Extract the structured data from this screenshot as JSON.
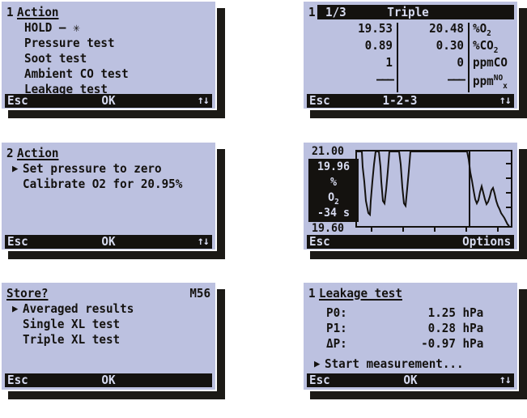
{
  "display": {
    "bg_color": "#bcc1e0",
    "fg_color": "#14120f",
    "border_color": "#ffffff",
    "shadow_color": "#1c1a16"
  },
  "panels": {
    "action_menu": {
      "index": "1",
      "title": "Action",
      "items": [
        {
          "label": "HOLD – ✳",
          "selected": false
        },
        {
          "label": "Pressure test",
          "selected": false
        },
        {
          "label": "Soot test",
          "selected": false
        },
        {
          "label": "Ambient CO test",
          "selected": false
        },
        {
          "label": "Leakage test",
          "selected": false
        }
      ],
      "statusbar": {
        "left": "Esc",
        "center": "OK",
        "right": "↑↓"
      }
    },
    "triple_measurement": {
      "index": "1",
      "header_left": "1/3",
      "header_center": "Triple",
      "rows": [
        {
          "col1": "19.53",
          "col2": "20.48",
          "unit": "%O",
          "unit_sub": "2",
          "unit_sup": ""
        },
        {
          "col1": "0.89",
          "col2": "0.30",
          "unit": "%CO",
          "unit_sub": "2",
          "unit_sup": ""
        },
        {
          "col1": "1",
          "col2": "0",
          "unit": "ppmCO",
          "unit_sub": "",
          "unit_sup": ""
        },
        {
          "col1": "———",
          "col2": "———",
          "unit": "ppm",
          "unit_sub": "x",
          "unit_sup": "NO"
        }
      ],
      "statusbar": {
        "left": "Esc",
        "center": "1-2-3",
        "right": "↑↓"
      }
    },
    "action_calibration": {
      "index": "2",
      "title": "Action",
      "items": [
        {
          "label": "Set pressure to zero",
          "selected": true
        },
        {
          "label": "Calibrate O2 for 20.95%",
          "selected": false
        }
      ],
      "statusbar": {
        "left": "Esc",
        "center": "OK",
        "right": "↑↓"
      }
    },
    "trend_graph": {
      "axis_top_label": "21.00",
      "axis_bottom_label": "19.60",
      "readout": {
        "value": "19.96",
        "unit": "%",
        "gas": "O",
        "gas_sub": "2",
        "time": "-34 s"
      },
      "statusbar": {
        "left": "Esc",
        "right": "Options"
      }
    },
    "store_dialog": {
      "title": "Store?",
      "memory": "M56",
      "items": [
        {
          "label": "Averaged results",
          "selected": true
        },
        {
          "label": "Single XL test",
          "selected": false
        },
        {
          "label": "Triple XL test",
          "selected": false
        }
      ],
      "statusbar": {
        "left": "Esc",
        "center": "OK",
        "right": ""
      }
    },
    "leakage_test": {
      "index": "1",
      "title": "Leakage test",
      "rows": [
        {
          "label": "P0:",
          "value": "1.25 hPa"
        },
        {
          "label": "P1:",
          "value": "0.28 hPa"
        },
        {
          "label": "ΔP:",
          "value": "-0.97 hPa"
        }
      ],
      "action": {
        "label": "Start measurement...",
        "selected": true
      },
      "statusbar": {
        "left": "Esc",
        "center": "OK",
        "right": "↑↓"
      }
    }
  },
  "chart_data": {
    "type": "line",
    "title": "",
    "xlabel": "",
    "ylabel": "%O2",
    "ylim": [
      19.6,
      21.0
    ],
    "ytick_labels": [
      "21.00",
      "19.60"
    ],
    "grid": false,
    "legend": "none",
    "cursor_readout": {
      "value": 19.96,
      "time_offset_s": -34
    },
    "series": [
      {
        "name": "O2",
        "values": [
          21.0,
          21.0,
          21.0,
          20.72,
          20.45,
          20.1,
          19.95,
          19.88,
          19.85,
          20.1,
          20.45,
          20.75,
          21.0,
          21.0,
          21.0,
          20.8,
          20.45,
          20.1,
          20.05,
          20.3,
          20.62,
          21.0,
          21.0,
          21.0,
          21.0,
          21.0,
          21.0,
          21.0,
          20.8,
          20.4,
          20.12,
          20.08,
          20.35,
          20.68,
          21.0,
          21.0,
          21.0,
          21.0,
          21.0,
          21.0,
          21.0,
          21.0,
          21.0,
          21.0,
          21.0,
          21.0,
          21.0,
          21.0,
          21.0,
          21.0,
          21.0,
          21.0,
          21.0,
          21.0,
          21.0,
          21.0,
          21.0,
          21.0,
          21.0,
          20.85,
          20.62,
          20.48,
          20.3,
          20.05,
          19.9,
          19.82,
          19.88,
          20.02,
          20.12,
          20.0,
          19.88,
          19.8,
          19.84,
          19.92,
          20.04,
          20.08,
          19.98,
          19.86,
          19.78,
          19.72,
          19.66,
          19.62,
          19.6
        ]
      }
    ]
  }
}
